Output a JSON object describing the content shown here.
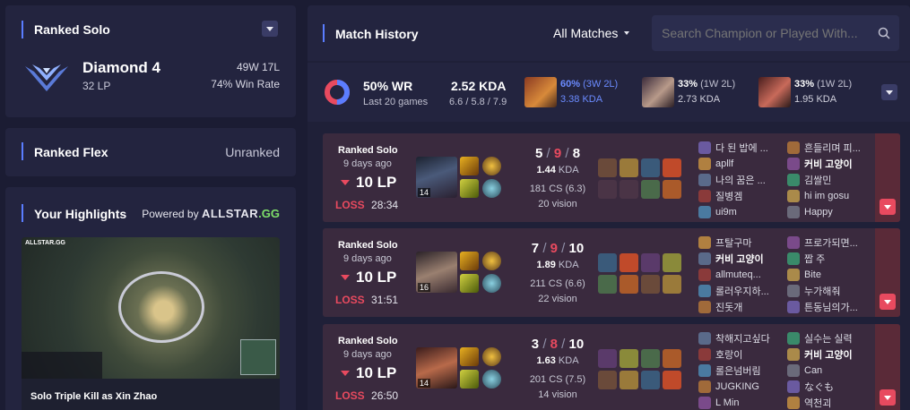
{
  "ranked_solo": {
    "title": "Ranked Solo",
    "tier": "Diamond 4",
    "lp": "32 LP",
    "record": "49W 17L",
    "win_rate": "74% Win Rate"
  },
  "ranked_flex": {
    "title": "Ranked Flex",
    "status": "Unranked"
  },
  "highlights": {
    "title": "Your Highlights",
    "powered_by": "Powered by",
    "brand": "ALLSTAR",
    "brand_suffix": ".GG",
    "thumb_brand": "ALLSTAR.GG",
    "clip_title": "Solo Triple Kill as Xin Zhao"
  },
  "match_history": {
    "title": "Match History",
    "filter": "All Matches",
    "search_placeholder": "Search Champion or Played With...",
    "summary": {
      "wr": "50% WR",
      "games": "Last 20 games",
      "kda": "2.52 KDA",
      "kda_detail": "6.6 / 5.8 / 7.9",
      "win_fraction": 0.5,
      "champs": [
        {
          "pct": "60%",
          "record": "(3W 2L)",
          "kda": "3.38 KDA",
          "highlight": true
        },
        {
          "pct": "33%",
          "record": "(1W 2L)",
          "kda": "2.73 KDA",
          "highlight": false
        },
        {
          "pct": "33%",
          "record": "(1W 2L)",
          "kda": "1.95 KDA",
          "highlight": false
        }
      ]
    },
    "matches": [
      {
        "queue": "Ranked Solo",
        "ago": "9 days ago",
        "lp": "10 LP",
        "result": "LOSS",
        "duration": "28:34",
        "level": "14",
        "k": "5",
        "d": "9",
        "a": "8",
        "kda": "1.44",
        "kda_label": "KDA",
        "cs": "181 CS (6.3)",
        "vision": "20 vision",
        "team1": [
          "다 된 밥에 ...",
          "apllf",
          "나의 꿈은 ...",
          "질병겜",
          "ui9m"
        ],
        "team2": [
          "흔들리며 피...",
          "커비 고양이",
          "김쌀민",
          "hi im gosu",
          "Happy"
        ],
        "bold2": 1
      },
      {
        "queue": "Ranked Solo",
        "ago": "9 days ago",
        "lp": "10 LP",
        "result": "LOSS",
        "duration": "31:51",
        "level": "16",
        "k": "7",
        "d": "9",
        "a": "10",
        "kda": "1.89",
        "kda_label": "KDA",
        "cs": "211 CS (6.6)",
        "vision": "22 vision",
        "team1": [
          "프탈구마",
          "커비 고양이",
          "allmuteq...",
          "롤러우지하...",
          "진돗개"
        ],
        "team2": [
          "프로가되면...",
          "짭 주",
          "Bite",
          "누가해줘",
          "튼동님의가..."
        ],
        "bold1": 1
      },
      {
        "queue": "Ranked Solo",
        "ago": "9 days ago",
        "lp": "10 LP",
        "result": "LOSS",
        "duration": "26:50",
        "level": "14",
        "k": "3",
        "d": "8",
        "a": "10",
        "kda": "1.63",
        "kda_label": "KDA",
        "cs": "201 CS (7.5)",
        "vision": "14 vision",
        "team1": [
          "착해지고싶다",
          "호랑이",
          "롤은넘버림",
          "JUGKING",
          "L Min"
        ],
        "team2": [
          "실수는 실력",
          "커비 고양이",
          "Can",
          "なぐも",
          "역천괴"
        ],
        "bold2": 1
      }
    ]
  },
  "colors": {
    "accent": "#5a7dff",
    "loss": "#e84a5f",
    "win_blue": "#5b7dff"
  }
}
